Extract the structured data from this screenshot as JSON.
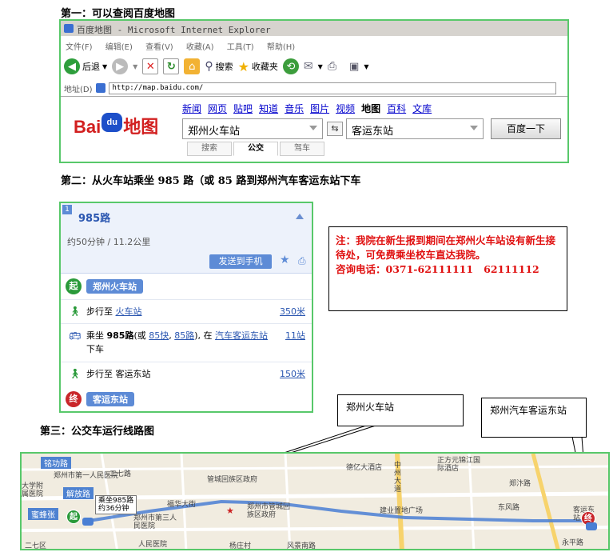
{
  "headings": {
    "step1": "第一：可以查阅百度地图",
    "step2": "第二：从火车站乘坐 985 路（或 85 路到郑州汽车客运东站下车",
    "step3": "第三：公交车运行线路图"
  },
  "ie": {
    "title": "百度地图 - Microsoft Internet Explorer",
    "menu": [
      "文件(F)",
      "编辑(E)",
      "查看(V)",
      "收藏(A)",
      "工具(T)",
      "帮助(H)"
    ],
    "toolbar": {
      "back": "后退",
      "search": "搜索",
      "favorites": "收藏夹"
    },
    "address_label": "地址(D)",
    "address": "http://map.baidu.com/"
  },
  "baidu": {
    "logo_text_left": "Bai",
    "logo_text_paw": "du",
    "logo_text_right": "地图",
    "nav": [
      "新闻",
      "网页",
      "贴吧",
      "知道",
      "音乐",
      "图片",
      "视频",
      "地图",
      "百科",
      "文库"
    ],
    "nav_current_index": 7,
    "from": "郑州火车站",
    "to": "客运东站",
    "swap_icon": "swap-icon",
    "search_button": "百度一下",
    "modes": [
      "搜索",
      "公交",
      "驾车"
    ],
    "active_mode": "公交"
  },
  "route": {
    "index": "1",
    "title": "985路",
    "summary": "约50分钟  / 11.2公里",
    "send_button": "发送到手机",
    "start_badge": "起",
    "start_name": "郑州火车站",
    "steps": [
      {
        "icon": "walk-icon",
        "prefix": "步行至 ",
        "link": "火车站",
        "meta": "350米"
      },
      {
        "icon": "bus-icon",
        "pre": "乘坐 ",
        "line": "985路",
        "mid": "(或 ",
        "alt1": "85快",
        "sep": ", ",
        "alt2": "85路",
        "post": "), 在 ",
        "stop": "汽车客运东站",
        "end": " 下车",
        "meta": "11站"
      },
      {
        "icon": "walk-icon",
        "prefix": "步行至 客运东站",
        "link": "",
        "meta": "150米"
      }
    ],
    "end_badge": "终",
    "end_name": "客运东站"
  },
  "notice": {
    "line1": "注：我院在新生报到期间在郑州火车站设有新生接待处，可免费乘坐校车直达我院。",
    "phone_label": "咨询电话：",
    "phone": "0371-62111111",
    "phone2": "62111112"
  },
  "callouts": {
    "left": "郑州火车站",
    "right": "郑州汽车客运东站"
  },
  "map": {
    "labels": {
      "road1": "铭功路",
      "road2": "解放路",
      "road3": "二七路",
      "place1": "大学附属医院",
      "place2": "福华大街",
      "place3": "郑州市管城回族区政府",
      "place4": "郑州市第三人民医院",
      "place5": "德亿大酒店",
      "place6": "中州大道",
      "place7": "建业置地广场",
      "place8": "正方元锦江国际酒店",
      "place9": "郑汴路",
      "place10": "管城回族区政府",
      "place11": "杨庄村",
      "place12": "风景南路",
      "place13": "永平路",
      "place14": "人民医院",
      "place15": "郑州市第一人民医院",
      "start_tag": "蜜蜂张",
      "bus_info1": "乘坐985路",
      "bus_info2": "约36分钟",
      "start_mark": "起",
      "end_mark": "终",
      "place16": "东风路",
      "place17": "客运东站",
      "place18": "二七区"
    }
  }
}
